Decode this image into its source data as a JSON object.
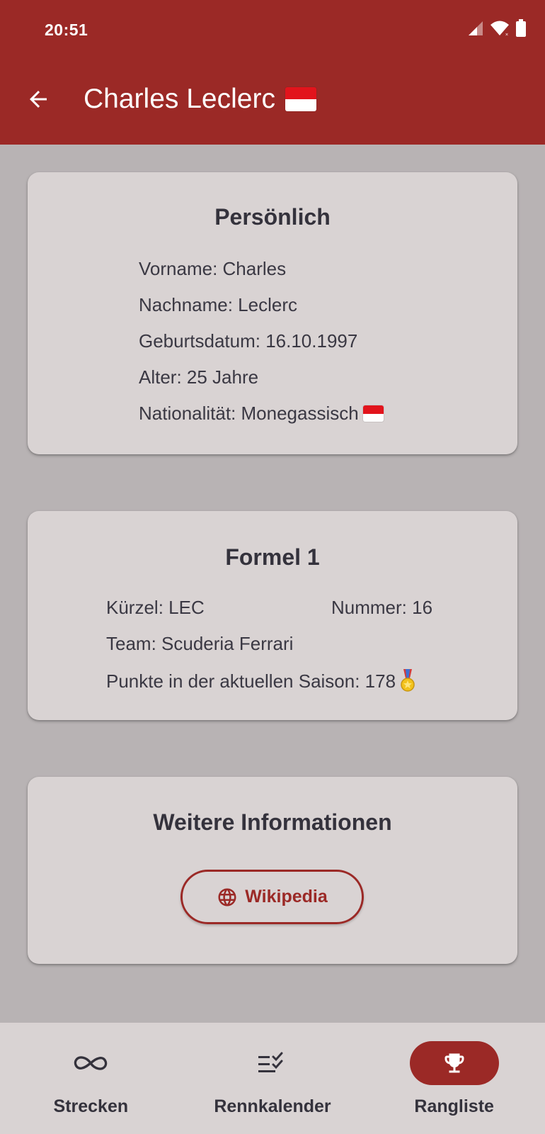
{
  "status_bar": {
    "time": "20:51"
  },
  "app_bar": {
    "title": "Charles Leclerc",
    "back_icon": "arrow-back-icon"
  },
  "colors": {
    "primary": "#9b2926",
    "surface": "#d9d3d3",
    "background": "#b8b3b4",
    "text": "#34323c"
  },
  "personal": {
    "heading": "Persönlich",
    "rows": [
      "Vorname: Charles",
      "Nachname: Leclerc",
      "Geburtsdatum: 16.10.1997",
      "Alter: 25 Jahre",
      "Nationalität: Monegassisch"
    ]
  },
  "formula1": {
    "heading": "Formel 1",
    "code": "Kürzel: LEC",
    "number": "Nummer: 16",
    "team": "Team: Scuderia Ferrari",
    "points": "Punkte in der aktuellen Saison: 178"
  },
  "more": {
    "heading": "Weitere Informationen",
    "wiki_label": "Wikipedia",
    "wiki_icon": "globe-icon"
  },
  "nav": {
    "items": [
      {
        "label": "Strecken",
        "icon": "infinity-icon"
      },
      {
        "label": "Rennkalender",
        "icon": "checklist-icon"
      },
      {
        "label": "Rangliste",
        "icon": "trophy-icon"
      }
    ],
    "active": "Rangliste"
  }
}
